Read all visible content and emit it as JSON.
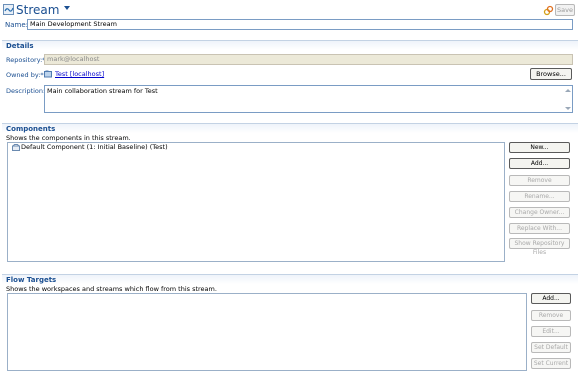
{
  "header": {
    "title": "Stream",
    "save_label": "Save"
  },
  "name_field": {
    "label": "Name:*",
    "value": "Main Development Stream"
  },
  "details": {
    "title": "Details",
    "repository_label": "Repository:*",
    "repository_value": "mark@localhost",
    "owned_by_label": "Owned by:*",
    "owned_by_value": "Test [localhost]",
    "browse_label": "Browse...",
    "description_label": "Description:",
    "description_value": "Main collaboration stream for Test"
  },
  "components": {
    "title": "Components",
    "description": "Shows the components in this stream.",
    "items": [
      "Default Component (1: Initial Baseline) (Test)"
    ],
    "buttons": [
      {
        "label": "New...",
        "enabled": true
      },
      {
        "label": "Add...",
        "enabled": true
      },
      {
        "label": "Remove",
        "enabled": false
      },
      {
        "label": "Rename...",
        "enabled": false
      },
      {
        "label": "Change Owner...",
        "enabled": false
      },
      {
        "label": "Replace With...",
        "enabled": false
      },
      {
        "label": "Show Repository Files",
        "enabled": false
      }
    ]
  },
  "flow_targets": {
    "title": "Flow Targets",
    "description": "Shows the workspaces and streams which flow from this stream.",
    "buttons": [
      {
        "label": "Add...",
        "enabled": true
      },
      {
        "label": "Remove",
        "enabled": false
      },
      {
        "label": "Edit...",
        "enabled": false
      },
      {
        "label": "Set Default",
        "enabled": false
      },
      {
        "label": "Set Current",
        "enabled": false
      }
    ]
  },
  "icons": {
    "header": "stream-icon",
    "link": "link-icon",
    "owner": "project-area-icon",
    "component": "component-icon"
  },
  "colors": {
    "accent": "#1b4f91",
    "link": "#0000cc",
    "disabled_text": "#a8a8a8"
  }
}
